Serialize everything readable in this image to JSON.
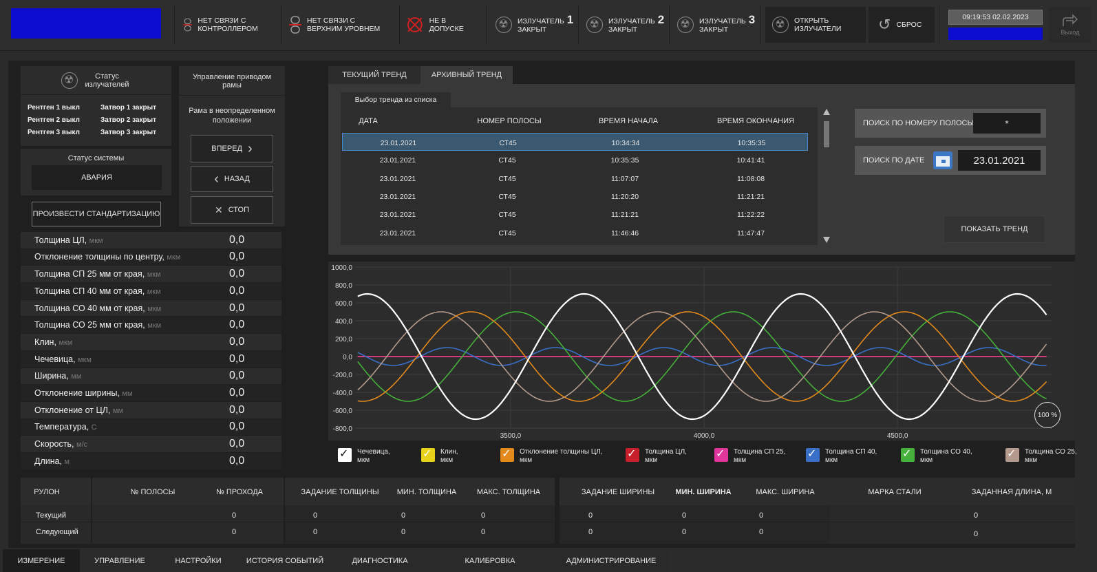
{
  "topbar": {
    "no_link_controller": "Нет связи с контроллером",
    "no_link_upper": "Нет связи с верхним уровнем",
    "not_admitted": "Не в допуске",
    "emitters": [
      {
        "label": "Излучатель",
        "num": "1",
        "state": "закрыт"
      },
      {
        "label": "Излучатель",
        "num": "2",
        "state": "закрыт"
      },
      {
        "label": "Излучатель",
        "num": "3",
        "state": "закрыт"
      }
    ],
    "open_emitters": "Открыть излучатели",
    "reset": "Сброс",
    "datetime": "09:19:53  02.02.2023",
    "exit": "Выход"
  },
  "emitter_status": {
    "title": "Статус излучателей",
    "rows": [
      {
        "xray": "Рентген 1 выкл",
        "shutter": "Затвор 1 закрыт"
      },
      {
        "xray": "Рентген 2 выкл",
        "shutter": "Затвор 2 закрыт"
      },
      {
        "xray": "Рентген 3 выкл",
        "shutter": "Затвор 3 закрыт"
      }
    ]
  },
  "system_status": {
    "title": "Статус системы",
    "value": "АВАРИЯ"
  },
  "standardize_button": "Произвести стандартизацию",
  "frame_drive": {
    "title": "Управление приводом рамы",
    "state": "Рама в неопределенном положении",
    "forward": "Вперед",
    "back": "Назад",
    "stop": "Стоп"
  },
  "measurements": [
    {
      "label": "Толщина ЦЛ, ",
      "unit": "мкм",
      "value": "0,0"
    },
    {
      "label": "Отклонение толщины по центру, ",
      "unit": "мкм",
      "value": "0,0"
    },
    {
      "label": "Толщина СП 25 мм от края, ",
      "unit": "мкм",
      "value": "0,0"
    },
    {
      "label": "Толщина СП 40 мм от края, ",
      "unit": "мкм",
      "value": "0,0"
    },
    {
      "label": "Толщина СО 40 мм от края, ",
      "unit": "мкм",
      "value": "0,0"
    },
    {
      "label": "Толщина СО 25 мм от края, ",
      "unit": "мкм",
      "value": "0,0"
    },
    {
      "label": "Клин, ",
      "unit": "мкм",
      "value": "0,0"
    },
    {
      "label": "Чечевица, ",
      "unit": "мкм",
      "value": "0,0"
    },
    {
      "label": "Ширина, ",
      "unit": "мм",
      "value": "0,0"
    },
    {
      "label": "Отклонение ширины, ",
      "unit": "мм",
      "value": "0,0"
    },
    {
      "label": "Отклонение от ЦЛ, ",
      "unit": "мм",
      "value": "0,0"
    },
    {
      "label": "Температура, ",
      "unit": "С",
      "value": "0,0"
    },
    {
      "label": "Скорость, ",
      "unit": "м/с",
      "value": "0,0"
    },
    {
      "label": "Длина, ",
      "unit": "м",
      "value": "0,0"
    }
  ],
  "trend_tabs": [
    "Текущий тренд",
    "Архивный тренд"
  ],
  "trend_select": {
    "title": "Выбор тренда из списка",
    "columns": [
      "Дата",
      "Номер полосы",
      "Время начала",
      "Время окончания"
    ],
    "rows": [
      [
        "23.01.2021",
        "СТ45",
        "10:34:34",
        "10:35:35"
      ],
      [
        "23.01.2021",
        "СТ45",
        "10:35:35",
        "10:41:41"
      ],
      [
        "23.01.2021",
        "СТ45",
        "11:07:07",
        "11:08:08"
      ],
      [
        "23.01.2021",
        "СТ45",
        "11:20:20",
        "11:21:21"
      ],
      [
        "23.01.2021",
        "СТ45",
        "11:21:21",
        "11:22:22"
      ],
      [
        "23.01.2021",
        "СТ45",
        "11:46:46",
        "11:47:47"
      ]
    ]
  },
  "search": {
    "by_strip_label": "Поиск по номеру полосы",
    "by_strip_value": "*",
    "by_date_label": "Поиск по дате",
    "by_date_value": "23.01.2021",
    "show_trend": "Показать тренд"
  },
  "chart_zoom": "100 %",
  "chart_data": {
    "type": "line",
    "ylim": [
      -800,
      1000
    ],
    "y_ticks": [
      "1000,0",
      "800,0",
      "600,0",
      "400,0",
      "200,0",
      "0,0",
      "-200,0",
      "-400,0",
      "-600,0",
      "-800,0"
    ],
    "xlim": [
      3100,
      4900
    ],
    "x_ticks": [
      "3500,0",
      "4000,0",
      "4500,0"
    ],
    "grid": true,
    "series": [
      {
        "name": "Чечевица, мкм",
        "color": "#ffffff",
        "amp": 700,
        "period": 560,
        "phase": 3550,
        "offset": 0
      },
      {
        "name": "Клин, мкм",
        "color": "#e8d21a",
        "amp": 0,
        "period": 560,
        "phase": 0,
        "offset": 0
      },
      {
        "name": "Отклонение толщины ЦЛ, мкм",
        "color": "#e48a1c",
        "amp": 500,
        "period": 560,
        "phase": 3258,
        "offset": 0
      },
      {
        "name": "Толщина ЦЛ, мкм",
        "color": "#c8202a",
        "amp": 0,
        "period": 560,
        "phase": 0,
        "offset": 0
      },
      {
        "name": "Толщина СП 25, мкм",
        "color": "#e0359a",
        "amp": 0,
        "period": 560,
        "phase": 0,
        "offset": 0
      },
      {
        "name": "Толщина СП 40, мкм",
        "color": "#3a6fc8",
        "amp": 100,
        "period": 280,
        "phase": 3266,
        "offset": 0
      },
      {
        "name": "Толщина СО 40, мкм",
        "color": "#45b03a",
        "amp": 500,
        "period": 560,
        "phase": 3375,
        "offset": 0
      },
      {
        "name": "Толщина СО 25, мкм",
        "color": "#b39a8c",
        "amp": 500,
        "period": 560,
        "phase": 3180,
        "offset": 0
      }
    ]
  },
  "legend": [
    {
      "l1": "Чечевица,",
      "l2": "мкм",
      "color": "#ffffff",
      "check": "#111111"
    },
    {
      "l1": "Клин,",
      "l2": "мкм",
      "color": "#e8d21a",
      "check": "#ffffff"
    },
    {
      "l1": "Отклонение толщины ЦЛ,",
      "l2": "мкм",
      "color": "#e48a1c",
      "check": "#ffffff"
    },
    {
      "l1": "Толщина ЦЛ,",
      "l2": "мкм",
      "color": "#c8202a",
      "check": "#ffffff"
    },
    {
      "l1": "Толщина СП 25,",
      "l2": "мкм",
      "color": "#e0359a",
      "check": "#ffffff"
    },
    {
      "l1": "Толщина СП 40,",
      "l2": "мкм",
      "color": "#3a6fc8",
      "check": "#ffffff"
    },
    {
      "l1": "Толщина СО 40,",
      "l2": "мкм",
      "color": "#45b03a",
      "check": "#ffffff"
    },
    {
      "l1": "Толщина СО 25,",
      "l2": "мкм",
      "color": "#b39a8c",
      "check": "#ffffff"
    }
  ],
  "coil_table": {
    "headers": [
      "Рулон",
      "№ полосы",
      "№ прохода",
      "Задание толщины",
      "Мин. толщина",
      "Макс. толщина",
      "Задание ширины",
      "Мин. ширина",
      "Макс. ширина",
      "Марка стали",
      "Заданная длина, м"
    ],
    "rows": [
      {
        "name": "Текущий",
        "strip": "",
        "pass": "0",
        "thk_set": "0",
        "thk_min": "0",
        "thk_max": "0",
        "w_set": "0",
        "w_min": "0",
        "w_max": "0",
        "steel": "",
        "len": "0"
      },
      {
        "name": "Следующий",
        "strip": "",
        "pass": "0",
        "thk_set": "0",
        "thk_min": "0",
        "thk_max": "0",
        "w_set": "0",
        "w_min": "0",
        "w_max": "0",
        "steel": "",
        "len": "0"
      }
    ]
  },
  "bottom_tabs": [
    "Измерение",
    "Управление",
    "Настройки",
    "История событий",
    "Диагностика",
    "Калибровка",
    "Администрирование"
  ]
}
